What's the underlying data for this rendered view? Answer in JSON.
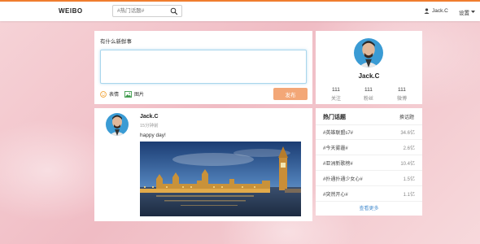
{
  "colors": {
    "accent": "#f07d2e",
    "publish_button": "#f3a777",
    "link": "#4a8fd0",
    "page_bg": "#f3c9cf"
  },
  "header": {
    "logo": "WEIBO",
    "search_placeholder": "#热门话题#",
    "search_icon": "search-icon",
    "user_icon": "user-icon",
    "user_name": "Jack.C",
    "settings_label": "设置"
  },
  "composer": {
    "title": "有什么新鲜事",
    "emoji_label": "表情",
    "image_label": "图片",
    "publish_label": "发布"
  },
  "post": {
    "author": "Jack.C",
    "time": "15分钟前",
    "text": "happy day!"
  },
  "profile": {
    "name": "Jack.C",
    "stats": [
      {
        "value": "111",
        "label": "关注"
      },
      {
        "value": "111",
        "label": "粉丝"
      },
      {
        "value": "111",
        "label": "微博"
      }
    ]
  },
  "topics": {
    "title": "热门话题",
    "refresh_label": "换话题",
    "items": [
      {
        "name": "#英雄联盟s7#",
        "count": "34.6亿"
      },
      {
        "name": "#今天雾霾#",
        "count": "2.6亿"
      },
      {
        "name": "#亚洲新歌榜#",
        "count": "10.4亿"
      },
      {
        "name": "#扑通扑通少女心#",
        "count": "1.5亿"
      },
      {
        "name": "#突然开心#",
        "count": "1.1亿"
      }
    ],
    "more_label": "查看更多"
  }
}
